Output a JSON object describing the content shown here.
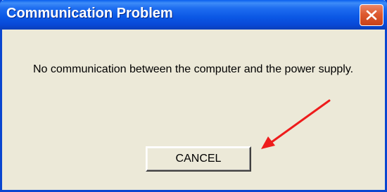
{
  "dialog": {
    "title": "Communication Problem",
    "message": "No communication between the computer and the power supply.",
    "cancel_label": "CANCEL"
  },
  "icons": {
    "close": "close-icon",
    "annotation": "red-arrow-icon"
  },
  "colors": {
    "title_bar": "#0a56e4",
    "dialog_background": "#ece9d8",
    "close_button": "#de5a30",
    "arrow": "#ee1c1c"
  }
}
